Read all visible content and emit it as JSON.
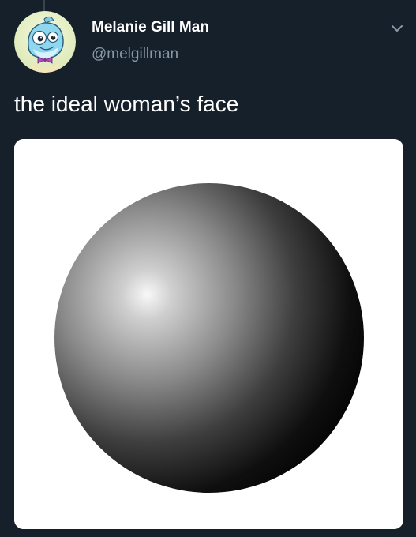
{
  "author": {
    "display_name": "Melanie Gill Man",
    "handle": "@melgillman",
    "avatar_icon": "fish-character-avatar"
  },
  "tweet": {
    "text": "the ideal woman’s face"
  },
  "media": {
    "description_icon": "shaded-sphere-image"
  },
  "menu": {
    "icon": "chevron-down-icon"
  },
  "colors": {
    "background": "#15202b",
    "primary_text": "#ffffff",
    "secondary_text": "#8899a6",
    "thread_line": "#38444d",
    "avatar_bg": "#e9f1c6"
  }
}
